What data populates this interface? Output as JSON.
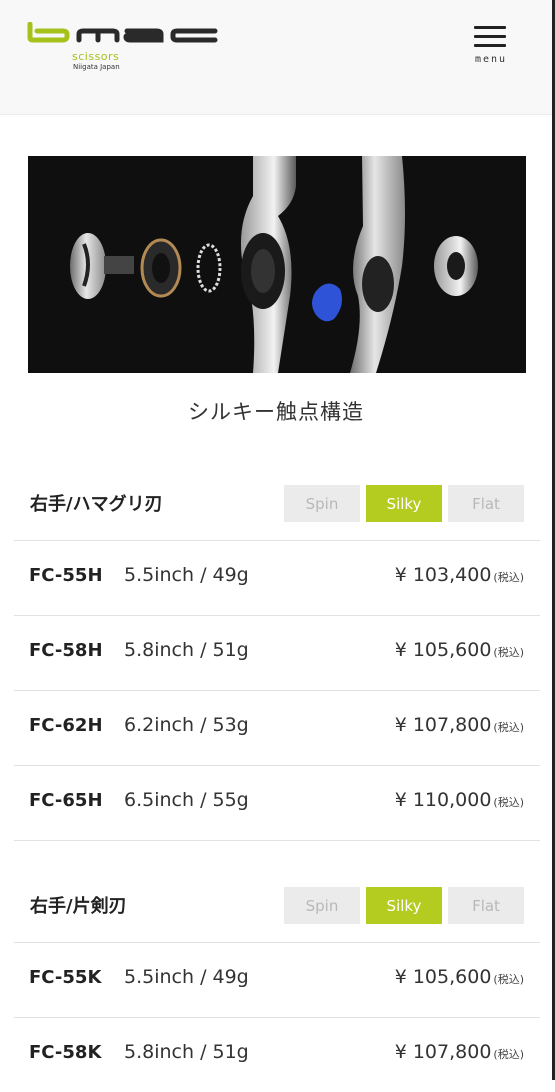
{
  "brand": {
    "logo_text": "bmac",
    "sub": "scissors",
    "location": "Niigata Japan",
    "accent": "#b3cc1f"
  },
  "menu": {
    "label": "menu",
    "icon": "hamburger-icon"
  },
  "hero": {
    "caption": "シルキー触点構造"
  },
  "sections": [
    {
      "title": "右手/ハマグリ刃",
      "tabs": [
        {
          "label": "Spin",
          "active": false
        },
        {
          "label": "Silky",
          "active": true
        },
        {
          "label": "Flat",
          "active": false
        }
      ],
      "rows": [
        {
          "model": "FC-55H",
          "spec": "5.5inch / 49g",
          "price": "¥ 103,400",
          "tax": "(税込)"
        },
        {
          "model": "FC-58H",
          "spec": "5.8inch / 51g",
          "price": "¥ 105,600",
          "tax": "(税込)"
        },
        {
          "model": "FC-62H",
          "spec": "6.2inch / 53g",
          "price": "¥ 107,800",
          "tax": "(税込)"
        },
        {
          "model": "FC-65H",
          "spec": "6.5inch / 55g",
          "price": "¥ 110,000",
          "tax": "(税込)"
        }
      ]
    },
    {
      "title": "右手/片剣刃",
      "tabs": [
        {
          "label": "Spin",
          "active": false
        },
        {
          "label": "Silky",
          "active": true
        },
        {
          "label": "Flat",
          "active": false
        }
      ],
      "rows": [
        {
          "model": "FC-55K",
          "spec": "5.5inch / 49g",
          "price": "¥ 105,600",
          "tax": "(税込)"
        },
        {
          "model": "FC-58K",
          "spec": "5.8inch / 51g",
          "price": "¥ 107,800",
          "tax": "(税込)"
        }
      ]
    }
  ]
}
